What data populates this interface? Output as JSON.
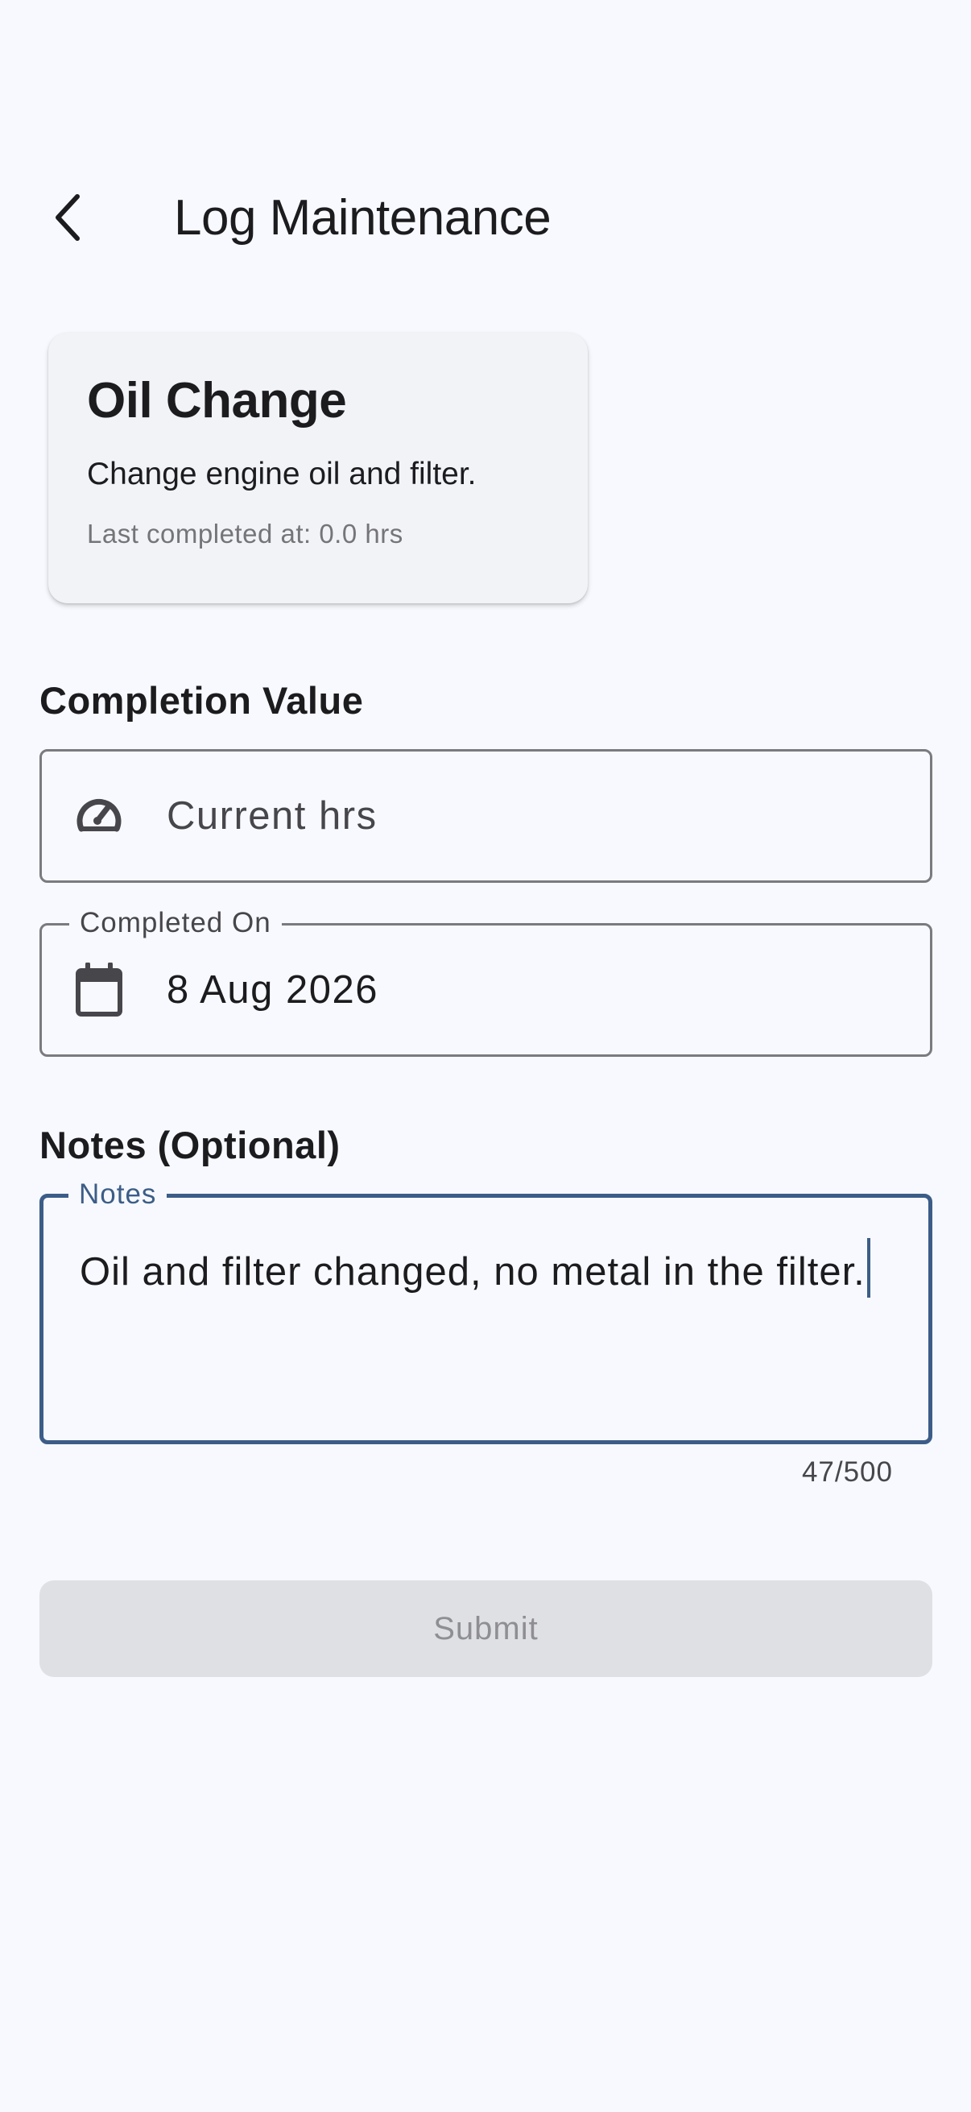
{
  "header": {
    "title": "Log Maintenance",
    "back_icon": "chevron-left-icon"
  },
  "task_card": {
    "title": "Oil Change",
    "description": "Change engine oil and filter.",
    "last_completed": "Last completed at: 0.0 hrs"
  },
  "completion": {
    "section_label": "Completion Value",
    "value_field": {
      "placeholder": "Current hrs",
      "value": "",
      "icon": "speedometer-icon"
    },
    "date_field": {
      "label": "Completed On",
      "value": "8 Aug 2026",
      "icon": "calendar-icon"
    }
  },
  "notes": {
    "section_label": "Notes (Optional)",
    "field_label": "Notes",
    "value": "Oil and filter changed, no metal in the filter.",
    "counter": "47/500"
  },
  "submit": {
    "label": "Submit",
    "enabled": false
  },
  "colors": {
    "background": "#f7f9fe",
    "accent": "#3c5d87",
    "disabled_button": "#dfe0e4"
  }
}
